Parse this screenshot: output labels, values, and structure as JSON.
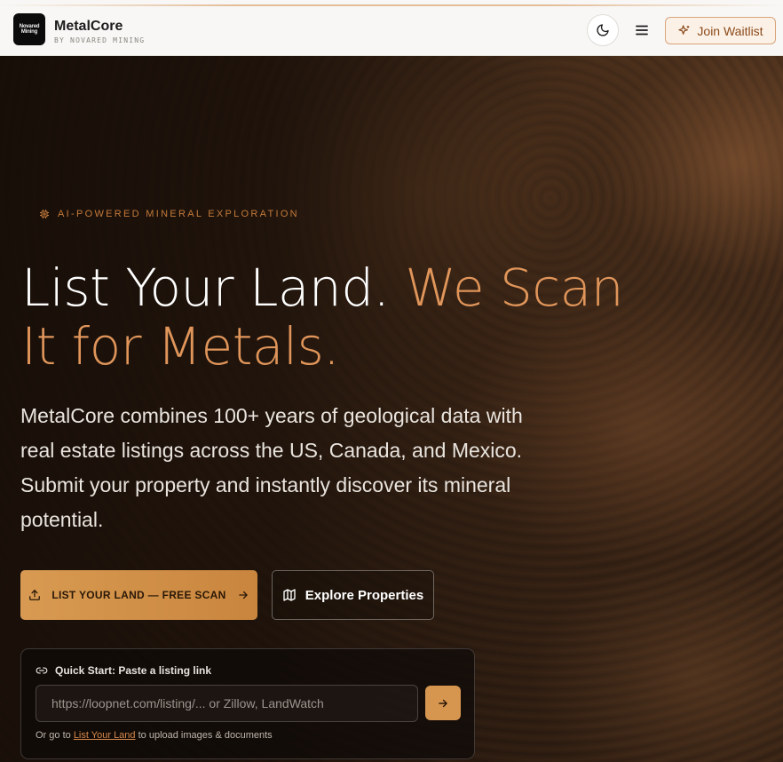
{
  "header": {
    "logo_text_line1": "Novared",
    "logo_text_line2": "Mining",
    "brand_name": "MetalCore",
    "brand_sub": "BY NOVARED MINING",
    "theme_icon": "moon-icon",
    "menu_icon": "hamburger-menu-icon",
    "waitlist_icon": "sparkles-icon",
    "waitlist_label": "Join Waitlist"
  },
  "hero": {
    "tagline_icon": "chip-icon",
    "tagline": "AI-POWERED MINERAL EXPLORATION",
    "headline_white": "List Your Land.",
    "headline_accent_1": "We Scan",
    "headline_accent_2": "It for Metals.",
    "subcopy": "MetalCore combines 100+ years of geological data with real estate listings across the US, Canada, and Mexico. Submit your property and instantly discover its mineral potential.",
    "primary_button": {
      "icon": "upload-icon",
      "label": "LIST YOUR LAND — FREE SCAN",
      "trailing_icon": "arrow-right-icon"
    },
    "secondary_button": {
      "icon": "map-icon",
      "label": "Explore Properties"
    }
  },
  "quick_start": {
    "icon": "link-icon",
    "title": "Quick Start: Paste a listing link",
    "input_placeholder": "https://loopnet.com/listing/... or Zillow, LandWatch",
    "input_value": "",
    "go_icon": "arrow-right-icon",
    "note_prefix": "Or go to",
    "note_link": "List Your Land",
    "note_suffix": "to upload images & documents"
  },
  "colors": {
    "accent": "#e0955a",
    "button_gradient_start": "#d89a52",
    "button_gradient_end": "#c9853d",
    "waitlist_border": "#d8a47a"
  }
}
